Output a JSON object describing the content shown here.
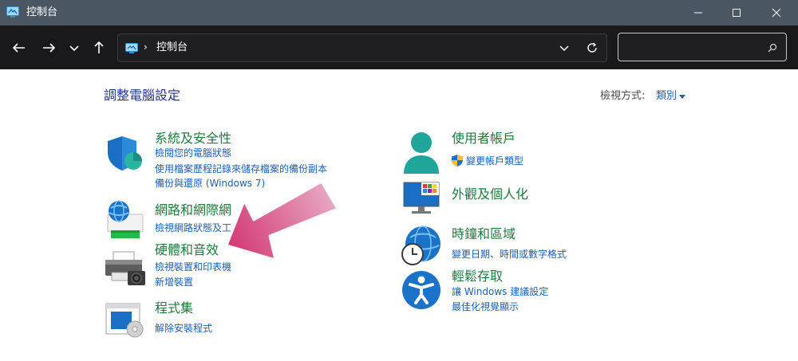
{
  "window": {
    "title": "控制台"
  },
  "address": {
    "path": "控制台",
    "separator": "›"
  },
  "search": {
    "placeholder": "",
    "value": ""
  },
  "page": {
    "heading": "調整電腦設定",
    "view_by_label": "檢視方式:",
    "view_by_value": "類別"
  },
  "categories_left": [
    {
      "title": "系統及安全性",
      "icon": "shield-icon",
      "links": [
        "檢閱您的電腦狀態",
        "使用檔案歷程記錄來儲存檔案的備份副本",
        "備份與還原 (Windows 7)"
      ]
    },
    {
      "title": "網路和網際網",
      "icon": "network-icon",
      "links": [
        "檢視網路狀態及工"
      ]
    },
    {
      "title": "硬體和音效",
      "icon": "printer-icon",
      "links": [
        "檢視裝置和印表機",
        "新增裝置"
      ]
    },
    {
      "title": "程式集",
      "icon": "programs-icon",
      "links": [
        "解除安裝程式"
      ]
    }
  ],
  "categories_right": [
    {
      "title": "使用者帳戶",
      "icon": "user-account-icon",
      "links": [
        "變更帳戶類型"
      ]
    },
    {
      "title": "外觀及個人化",
      "icon": "appearance-icon",
      "links": []
    },
    {
      "title": "時鐘和區域",
      "icon": "clock-globe-icon",
      "links": [
        "變更日期、時間或數字格式"
      ]
    },
    {
      "title": "輕鬆存取",
      "icon": "accessibility-icon",
      "links": [
        "讓 Windows 建議設定",
        "最佳化視覺顯示"
      ]
    }
  ],
  "colors": {
    "titlebar": "#4a5763",
    "addressbar": "#19191b",
    "category_title": "#217a3c",
    "link": "#1a5fb4",
    "heading": "#1e3287",
    "arrow": "#d23c78"
  }
}
